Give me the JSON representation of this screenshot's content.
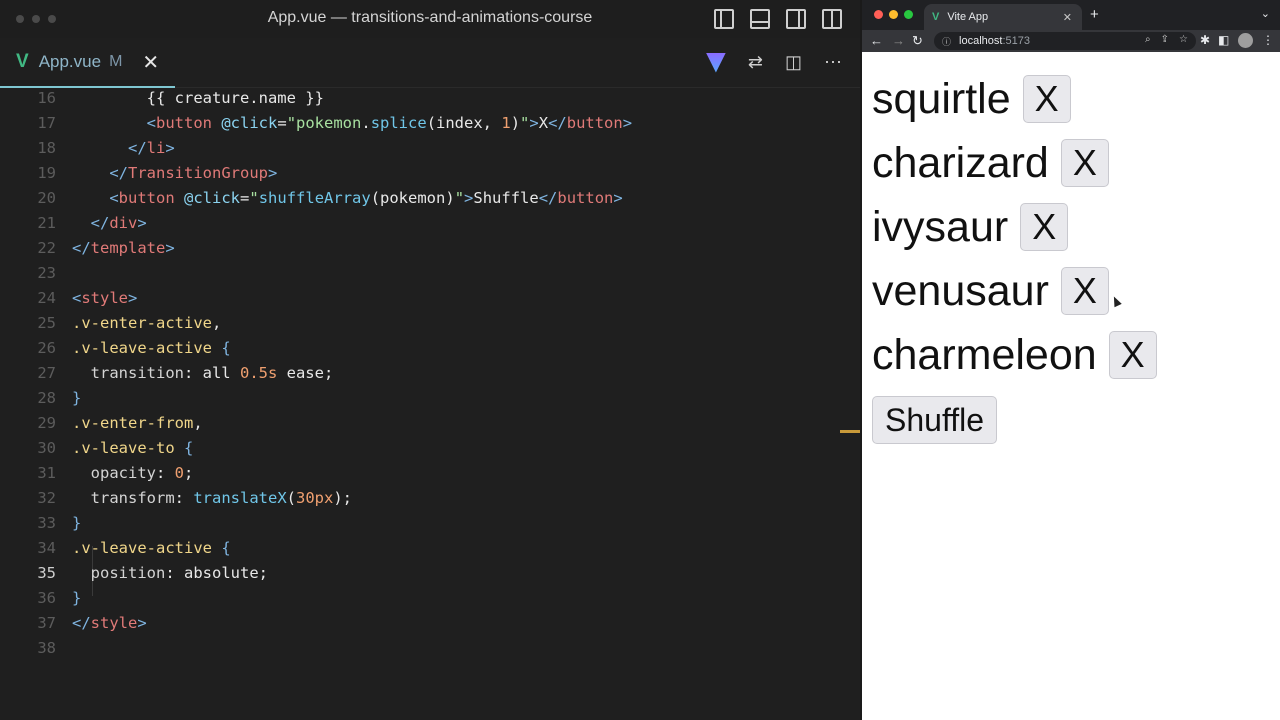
{
  "editor": {
    "window_title": "App.vue — transitions-and-animations-course",
    "tab": {
      "name": "App.vue",
      "modified": "M",
      "close": "✕"
    },
    "code_lines": [
      {
        "n": "16",
        "segments": [
          [
            "plain",
            "        {{ creature.name }}"
          ]
        ]
      },
      {
        "n": "17",
        "segments": [
          [
            "plain",
            "        "
          ],
          [
            "tag",
            "<"
          ],
          [
            "tagname",
            "button"
          ],
          [
            "plain",
            " "
          ],
          [
            "attr",
            "@click"
          ],
          [
            "plain",
            "="
          ],
          [
            "str",
            "\"pokemon"
          ],
          [
            "plain",
            "."
          ],
          [
            "fn",
            "splice"
          ],
          [
            "plain",
            "(index, "
          ],
          [
            "num",
            "1"
          ],
          [
            "plain",
            ")"
          ],
          [
            "str",
            "\""
          ],
          [
            "tag",
            ">"
          ],
          [
            "plain",
            "X"
          ],
          [
            "tag",
            "</"
          ],
          [
            "tagname",
            "button"
          ],
          [
            "tag",
            ">"
          ]
        ]
      },
      {
        "n": "18",
        "segments": [
          [
            "plain",
            "      "
          ],
          [
            "tag",
            "</"
          ],
          [
            "tagname",
            "li"
          ],
          [
            "tag",
            ">"
          ]
        ]
      },
      {
        "n": "19",
        "segments": [
          [
            "plain",
            "    "
          ],
          [
            "tag",
            "</"
          ],
          [
            "tagname",
            "TransitionGroup"
          ],
          [
            "tag",
            ">"
          ]
        ]
      },
      {
        "n": "20",
        "segments": [
          [
            "plain",
            "    "
          ],
          [
            "tag",
            "<"
          ],
          [
            "tagname",
            "button"
          ],
          [
            "plain",
            " "
          ],
          [
            "attr",
            "@click"
          ],
          [
            "plain",
            "="
          ],
          [
            "str",
            "\""
          ],
          [
            "fn",
            "shuffleArray"
          ],
          [
            "plain",
            "(pokemon)"
          ],
          [
            "str",
            "\""
          ],
          [
            "tag",
            ">"
          ],
          [
            "plain",
            "Shuffle"
          ],
          [
            "tag",
            "</"
          ],
          [
            "tagname",
            "button"
          ],
          [
            "tag",
            ">"
          ]
        ]
      },
      {
        "n": "21",
        "segments": [
          [
            "plain",
            "  "
          ],
          [
            "tag",
            "</"
          ],
          [
            "tagname",
            "div"
          ],
          [
            "tag",
            ">"
          ]
        ]
      },
      {
        "n": "22",
        "segments": [
          [
            "tag",
            "</"
          ],
          [
            "tagname",
            "template"
          ],
          [
            "tag",
            ">"
          ]
        ]
      },
      {
        "n": "23",
        "segments": [
          [
            "plain",
            ""
          ]
        ]
      },
      {
        "n": "24",
        "segments": [
          [
            "tag",
            "<"
          ],
          [
            "tagname",
            "style"
          ],
          [
            "tag",
            ">"
          ]
        ]
      },
      {
        "n": "25",
        "segments": [
          [
            "sel",
            ".v-enter-active"
          ],
          [
            "plain",
            ","
          ]
        ]
      },
      {
        "n": "26",
        "segments": [
          [
            "sel",
            ".v-leave-active"
          ],
          [
            "plain",
            " "
          ],
          [
            "tag",
            "{"
          ]
        ]
      },
      {
        "n": "27",
        "segments": [
          [
            "prop",
            "  transition"
          ],
          [
            "plain",
            ": all "
          ],
          [
            "num",
            "0.5s"
          ],
          [
            "plain",
            " ease;"
          ]
        ]
      },
      {
        "n": "28",
        "segments": [
          [
            "tag",
            "}"
          ]
        ]
      },
      {
        "n": "29",
        "segments": [
          [
            "sel",
            ".v-enter-from"
          ],
          [
            "plain",
            ","
          ]
        ]
      },
      {
        "n": "30",
        "segments": [
          [
            "sel",
            ".v-leave-to"
          ],
          [
            "plain",
            " "
          ],
          [
            "tag",
            "{"
          ]
        ]
      },
      {
        "n": "31",
        "segments": [
          [
            "prop",
            "  opacity"
          ],
          [
            "plain",
            ": "
          ],
          [
            "num",
            "0"
          ],
          [
            "plain",
            ";"
          ]
        ]
      },
      {
        "n": "32",
        "segments": [
          [
            "prop",
            "  transform"
          ],
          [
            "plain",
            ": "
          ],
          [
            "fn",
            "translateX"
          ],
          [
            "plain",
            "("
          ],
          [
            "num",
            "30px"
          ],
          [
            "plain",
            ");"
          ]
        ]
      },
      {
        "n": "33",
        "segments": [
          [
            "tag",
            "}"
          ]
        ]
      },
      {
        "n": "34",
        "segments": [
          [
            "sel",
            ".v-leave-active"
          ],
          [
            "plain",
            " "
          ],
          [
            "tag",
            "{"
          ]
        ]
      },
      {
        "n": "35",
        "segments": [
          [
            "prop",
            "  position"
          ],
          [
            "plain",
            ": absolute;"
          ]
        ]
      },
      {
        "n": "36",
        "segments": [
          [
            "tag",
            "}"
          ]
        ]
      },
      {
        "n": "37",
        "segments": [
          [
            "tag",
            "</"
          ],
          [
            "tagname",
            "style"
          ],
          [
            "tag",
            ">"
          ]
        ]
      },
      {
        "n": "38",
        "segments": [
          [
            "plain",
            ""
          ]
        ]
      }
    ],
    "active_line": "35"
  },
  "browser": {
    "tab_title": "Vite App",
    "tab_close": "✕",
    "url_host": "localhost",
    "url_port": ":5173",
    "items": [
      {
        "name": "squirtle",
        "button": "X"
      },
      {
        "name": "charizard",
        "button": "X"
      },
      {
        "name": "ivysaur",
        "button": "X"
      },
      {
        "name": "venusaur",
        "button": "X"
      },
      {
        "name": "charmeleon",
        "button": "X"
      }
    ],
    "shuffle_label": "Shuffle"
  }
}
